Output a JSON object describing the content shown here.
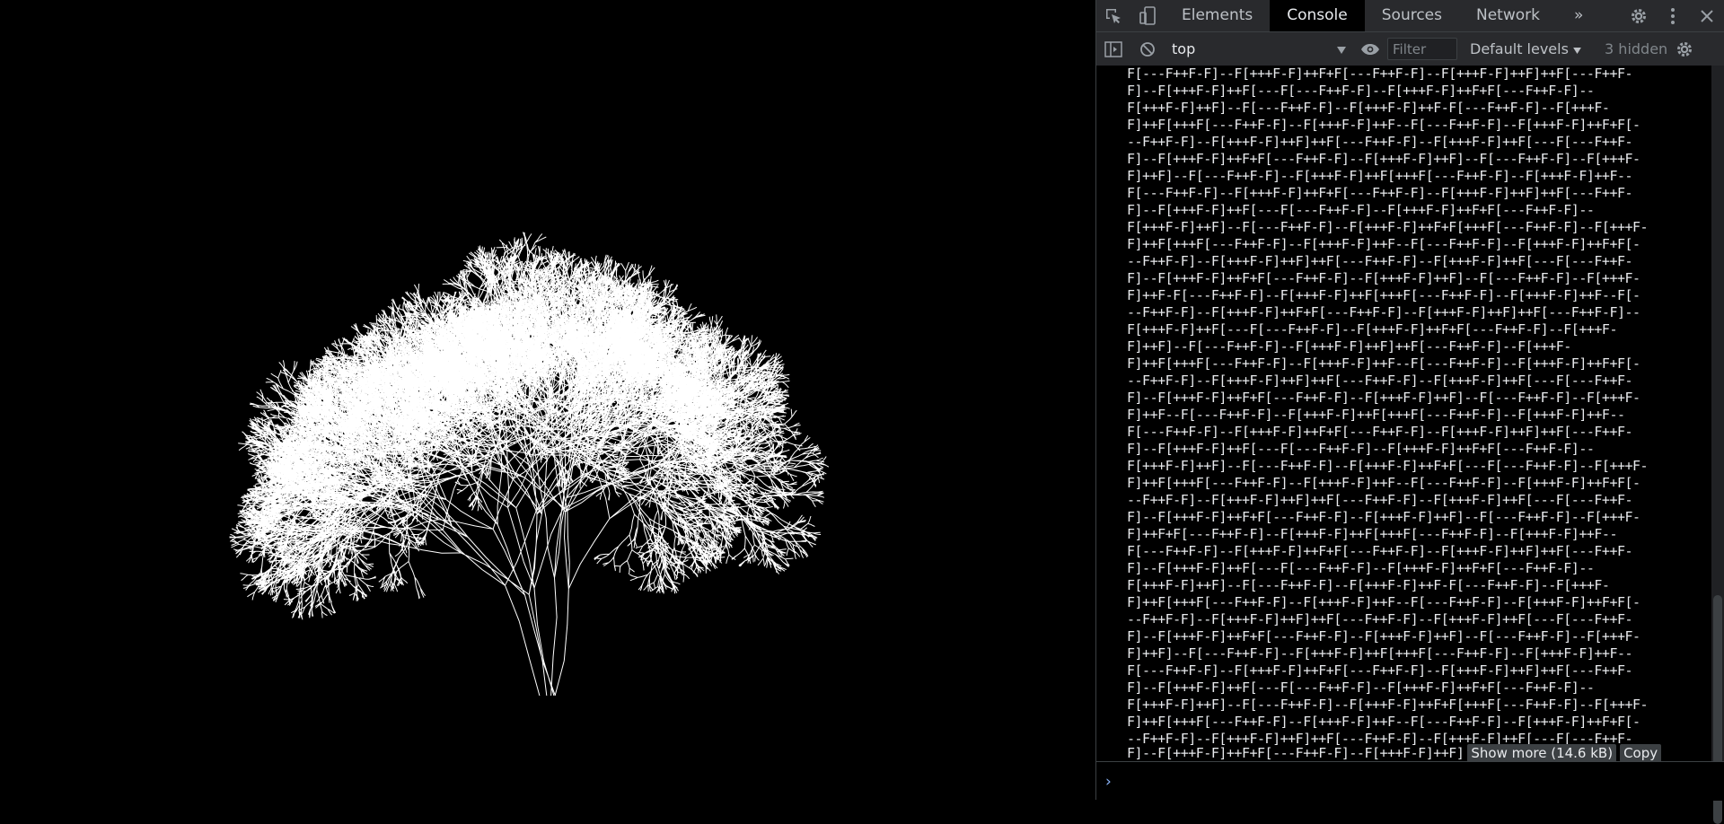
{
  "devtools": {
    "tabs": [
      "Elements",
      "Console",
      "Sources",
      "Network"
    ],
    "active_tab": "Console",
    "more_tabs_glyph": "»",
    "icons": [
      "inspect-icon",
      "device-toggle-icon",
      "gear-icon",
      "more-vert-icon",
      "close-icon"
    ]
  },
  "toolbar": {
    "context": "top",
    "filter_placeholder": "Filter",
    "levels": "Default levels",
    "hidden": "3 hidden"
  },
  "console": {
    "lines": [
      "F[---F++F-F]--F[+++F-F]++F+F[---F++F-F]--F[+++F-F]++F]++F[---F++F-",
      "F]--F[+++F-F]++F[---F[---F++F-F]--F[+++F-F]++F+F[---F++F-F]--",
      "F[+++F-F]++F]--F[---F++F-F]--F[+++F-F]++F-F[---F++F-F]--F[+++F-",
      "F]++F[+++F[---F++F-F]--F[+++F-F]++F--F[---F++F-F]--F[+++F-F]++F+F[-",
      "--F++F-F]--F[+++F-F]++F]++F[---F++F-F]--F[+++F-F]++F[---F[---F++F-",
      "F]--F[+++F-F]++F+F[---F++F-F]--F[+++F-F]++F]--F[---F++F-F]--F[+++F-",
      "F]++F]--F[---F++F-F]--F[+++F-F]++F[+++F[---F++F-F]--F[+++F-F]++F--",
      "F[---F++F-F]--F[+++F-F]++F+F[---F++F-F]--F[+++F-F]++F]++F[---F++F-",
      "F]--F[+++F-F]++F[---F[---F++F-F]--F[+++F-F]++F+F[---F++F-F]--",
      "F[+++F-F]++F]--F[---F++F-F]--F[+++F-F]++F+F[+++F[---F++F-F]--F[+++F-",
      "F]++F[+++F[---F++F-F]--F[+++F-F]++F--F[---F++F-F]--F[+++F-F]++F+F[-",
      "--F++F-F]--F[+++F-F]++F]++F[---F++F-F]--F[+++F-F]++F[---F[---F++F-",
      "F]--F[+++F-F]++F+F[---F++F-F]--F[+++F-F]++F]--F[---F++F-F]--F[+++F-",
      "F]++F-F[---F++F-F]--F[+++F-F]++F[+++F[---F++F-F]--F[+++F-F]++F--F[-",
      "--F++F-F]--F[+++F-F]++F+F[---F++F-F]--F[+++F-F]++F]++F[---F++F-F]--",
      "F[+++F-F]++F[---F[---F++F-F]--F[+++F-F]++F+F[---F++F-F]--F[+++F-",
      "F]++F]--F[---F++F-F]--F[+++F-F]++F]++F[---F++F-F]--F[+++F-",
      "F]++F[+++F[---F++F-F]--F[+++F-F]++F--F[---F++F-F]--F[+++F-F]++F+F[-",
      "--F++F-F]--F[+++F-F]++F]++F[---F++F-F]--F[+++F-F]++F[---F[---F++F-",
      "F]--F[+++F-F]++F+F[---F++F-F]--F[+++F-F]++F]--F[---F++F-F]--F[+++F-",
      "F]++F--F[---F++F-F]--F[+++F-F]++F[+++F[---F++F-F]--F[+++F-F]++F--",
      "F[---F++F-F]--F[+++F-F]++F+F[---F++F-F]--F[+++F-F]++F]++F[---F++F-",
      "F]--F[+++F-F]++F[---F[---F++F-F]--F[+++F-F]++F+F[---F++F-F]--",
      "F[+++F-F]++F]--F[---F++F-F]--F[+++F-F]++F+F[---F[---F++F-F]--F[+++F-",
      "F]++F[+++F[---F++F-F]--F[+++F-F]++F--F[---F++F-F]--F[+++F-F]++F+F[-",
      "--F++F-F]--F[+++F-F]++F]++F[---F++F-F]--F[+++F-F]++F[---F[---F++F-",
      "F]--F[+++F-F]++F+F[---F++F-F]--F[+++F-F]++F]--F[---F++F-F]--F[+++F-",
      "F]++F+F[---F++F-F]--F[+++F-F]++F[+++F[---F++F-F]--F[+++F-F]++F--",
      "F[---F++F-F]--F[+++F-F]++F+F[---F++F-F]--F[+++F-F]++F]++F[---F++F-",
      "F]--F[+++F-F]++F[---F[---F++F-F]--F[+++F-F]++F+F[---F++F-F]--",
      "F[+++F-F]++F]--F[---F++F-F]--F[+++F-F]++F-F[---F++F-F]--F[+++F-",
      "F]++F[+++F[---F++F-F]--F[+++F-F]++F--F[---F++F-F]--F[+++F-F]++F+F[-",
      "--F++F-F]--F[+++F-F]++F]++F[---F++F-F]--F[+++F-F]++F[---F[---F++F-",
      "F]--F[+++F-F]++F+F[---F++F-F]--F[+++F-F]++F]--F[---F++F-F]--F[+++F-",
      "F]++F]--F[---F++F-F]--F[+++F-F]++F[+++F[---F++F-F]--F[+++F-F]++F--",
      "F[---F++F-F]--F[+++F-F]++F+F[---F++F-F]--F[+++F-F]++F]++F[---F++F-",
      "F]--F[+++F-F]++F[---F[---F++F-F]--F[+++F-F]++F+F[---F++F-F]--",
      "F[+++F-F]++F]--F[---F++F-F]--F[+++F-F]++F+F[+++F[---F++F-F]--F[+++F-",
      "F]++F[+++F[---F++F-F]--F[+++F-F]++F--F[---F++F-F]--F[+++F-F]++F+F[-",
      "--F++F-F]--F[+++F-F]++F]++F[---F++F-F]--F[+++F-F]++F[---F[---F++F-"
    ],
    "last_line": "F]--F[+++F-F]++F+F[---F++F-F]--F[+++F-F]++F]",
    "show_more": "Show more (14.6 kB)",
    "copy": "Copy",
    "prompt": "›"
  }
}
